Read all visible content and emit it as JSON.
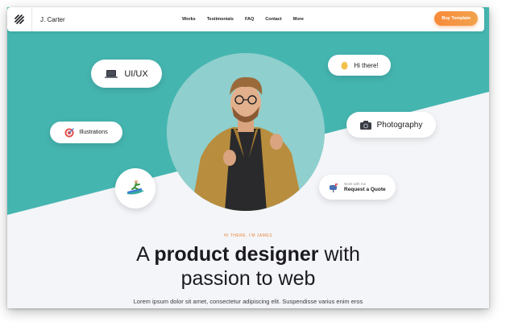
{
  "navbar": {
    "brand": "J. Carter",
    "links": [
      "Works",
      "Testimonials",
      "FAQ",
      "Contact",
      "More"
    ],
    "cta": "Buy Template"
  },
  "hero": {
    "chips": {
      "uiux": "UI/UX",
      "hi": "Hi there!",
      "illustrations": "Illustrations",
      "photography": "Photography",
      "quote_small": "Work with me",
      "quote_main": "Request a Quote"
    },
    "eyebrow": "HI THERE, I'M JAMES",
    "headline_pre": "A ",
    "headline_bold": "product designer",
    "headline_post": " with",
    "headline_line2": "passion to web",
    "subtext": "Lorem ipsum dolor sit amet, consectetur adipiscing elit. Suspendisse varius enim eros"
  },
  "colors": {
    "teal": "#45b5b0",
    "accent": "#f78a3a",
    "light_bg": "#f4f5f8"
  },
  "icons": [
    "logo-mark-icon",
    "laptop-icon",
    "wave-hand-icon",
    "target-icon",
    "camera-icon",
    "mailbox-icon",
    "surfer-icon"
  ]
}
